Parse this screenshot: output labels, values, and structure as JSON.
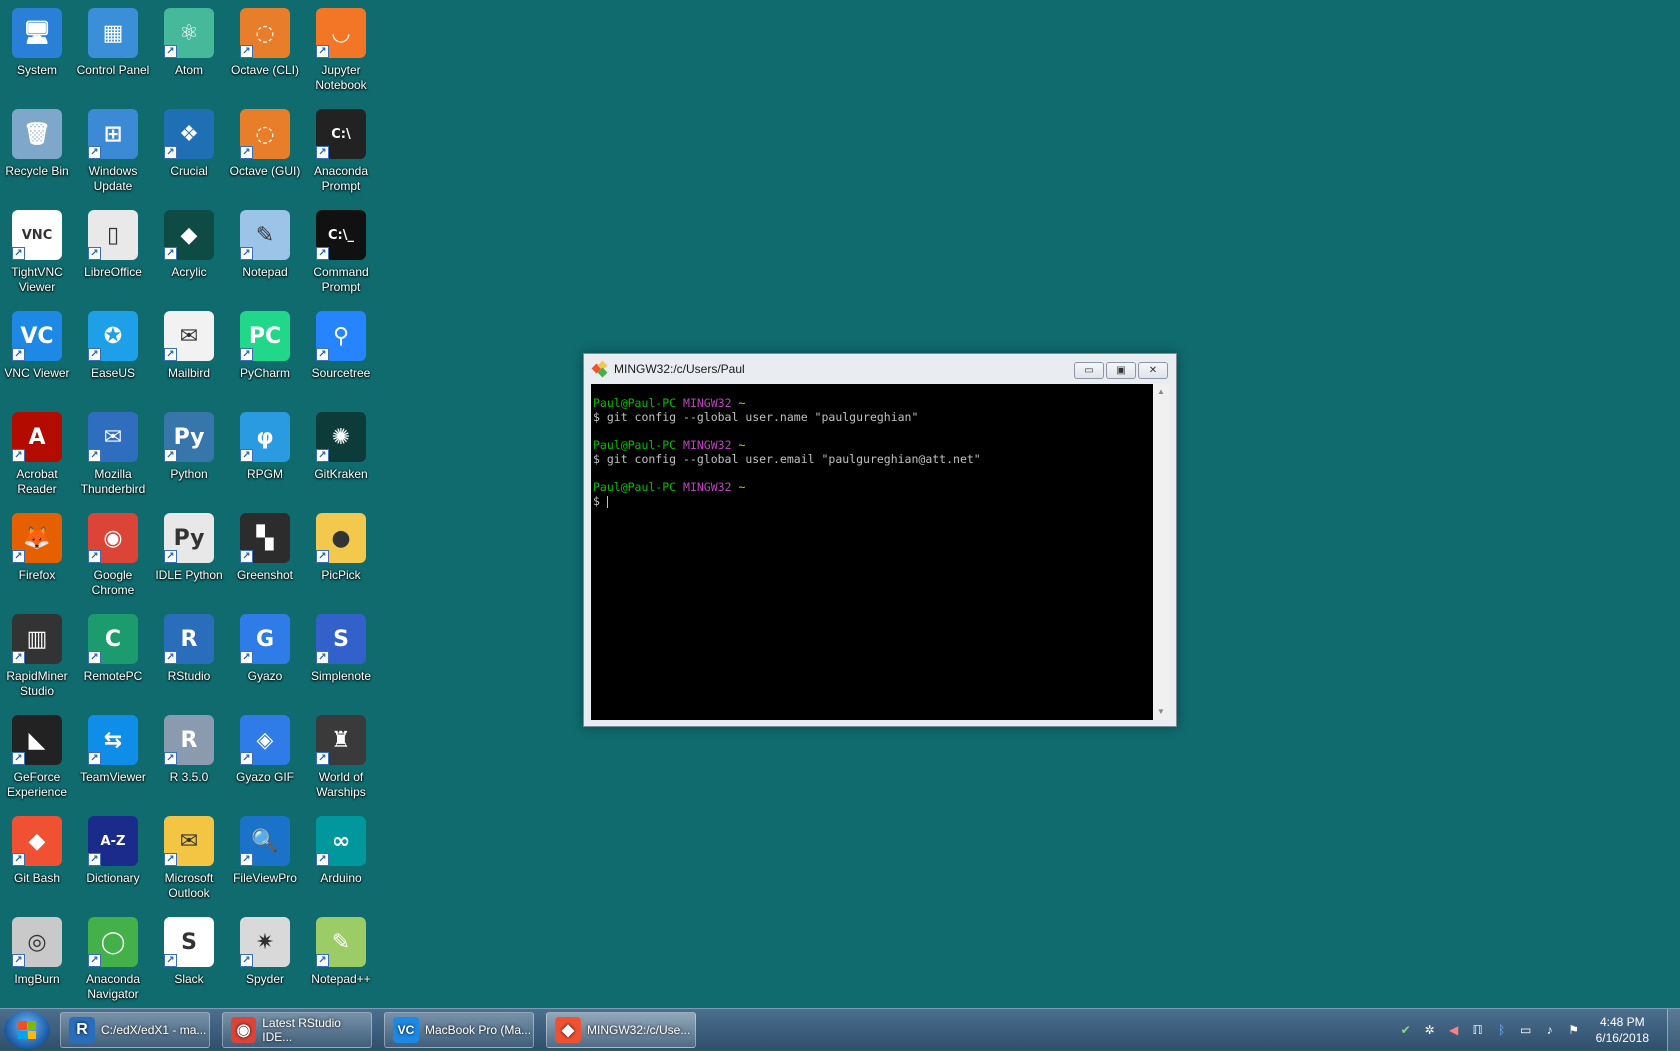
{
  "desktop": {
    "icons": [
      {
        "label": "System",
        "color": "#2a7fd6",
        "glyph": "🖥",
        "shortcut": false
      },
      {
        "label": "Control Panel",
        "color": "#3a8fd8",
        "glyph": "▦",
        "shortcut": false
      },
      {
        "label": "Atom",
        "color": "#46b99a",
        "glyph": "⚛",
        "shortcut": true
      },
      {
        "label": "Octave (CLI)",
        "color": "#e87d2a",
        "glyph": "◌",
        "shortcut": true
      },
      {
        "label": "Jupyter Notebook",
        "color": "#f37626",
        "glyph": "◡",
        "shortcut": true
      },
      {
        "label": "Recycle Bin",
        "color": "#7fa7c9",
        "glyph": "🗑",
        "shortcut": false
      },
      {
        "label": "Windows Update",
        "color": "#3c8ad6",
        "glyph": "⊞",
        "shortcut": true
      },
      {
        "label": "Crucial",
        "color": "#1f6fb5",
        "glyph": "❖",
        "shortcut": true
      },
      {
        "label": "Octave (GUI)",
        "color": "#e87d2a",
        "glyph": "◌",
        "shortcut": true
      },
      {
        "label": "Anaconda Prompt",
        "color": "#222222",
        "glyph": "C:\\",
        "shortcut": true
      },
      {
        "label": "TightVNC Viewer",
        "color": "#ffffff",
        "glyph": "VNC",
        "shortcut": true
      },
      {
        "label": "LibreOffice",
        "color": "#e9e9e9",
        "glyph": "▯",
        "shortcut": true
      },
      {
        "label": "Acrylic",
        "color": "#0f4b45",
        "glyph": "◆",
        "shortcut": true
      },
      {
        "label": "Notepad",
        "color": "#9cc4e8",
        "glyph": "✎",
        "shortcut": true
      },
      {
        "label": "Command Prompt",
        "color": "#111111",
        "glyph": "C:\\_",
        "shortcut": true
      },
      {
        "label": "VNC Viewer",
        "color": "#1e88e5",
        "glyph": "VC",
        "shortcut": true
      },
      {
        "label": "EaseUS",
        "color": "#1ea0e8",
        "glyph": "✪",
        "shortcut": true
      },
      {
        "label": "Mailbird",
        "color": "#f2f2f2",
        "glyph": "✉",
        "shortcut": true
      },
      {
        "label": "PyCharm",
        "color": "#21d789",
        "glyph": "PC",
        "shortcut": true
      },
      {
        "label": "Sourcetree",
        "color": "#2684ff",
        "glyph": "⚲",
        "shortcut": true
      },
      {
        "label": "Acrobat Reader",
        "color": "#b30b00",
        "glyph": "A",
        "shortcut": true
      },
      {
        "label": "Mozilla Thunderbird",
        "color": "#2f6dbf",
        "glyph": "✉",
        "shortcut": true
      },
      {
        "label": "Python",
        "color": "#3776ab",
        "glyph": "Py",
        "shortcut": true
      },
      {
        "label": "RPGM",
        "color": "#2a9be0",
        "glyph": "φ",
        "shortcut": true
      },
      {
        "label": "GitKraken",
        "color": "#0c3b3a",
        "glyph": "✺",
        "shortcut": true
      },
      {
        "label": "Firefox",
        "color": "#e66000",
        "glyph": "🦊",
        "shortcut": true
      },
      {
        "label": "Google Chrome",
        "color": "#db4437",
        "glyph": "◉",
        "shortcut": true
      },
      {
        "label": "IDLE Python",
        "color": "#e8e8e8",
        "glyph": "Py",
        "shortcut": true
      },
      {
        "label": "Greenshot",
        "color": "#2c2c2c",
        "glyph": "▚",
        "shortcut": true
      },
      {
        "label": "PicPick",
        "color": "#f2c94c",
        "glyph": "●",
        "shortcut": true
      },
      {
        "label": "RapidMiner Studio",
        "color": "#333333",
        "glyph": "▥",
        "shortcut": true
      },
      {
        "label": "RemotePC",
        "color": "#1c9b6e",
        "glyph": "C",
        "shortcut": true
      },
      {
        "label": "RStudio",
        "color": "#2a6ebb",
        "glyph": "R",
        "shortcut": true
      },
      {
        "label": "Gyazo",
        "color": "#2f7ce8",
        "glyph": "G",
        "shortcut": true
      },
      {
        "label": "Simplenote",
        "color": "#3361cc",
        "glyph": "S",
        "shortcut": true
      },
      {
        "label": "GeForce Experience",
        "color": "#222222",
        "glyph": "◣",
        "shortcut": true
      },
      {
        "label": "TeamViewer",
        "color": "#0e8ee9",
        "glyph": "⇆",
        "shortcut": true
      },
      {
        "label": "R 3.5.0",
        "color": "#8a9bb0",
        "glyph": "R",
        "shortcut": true
      },
      {
        "label": "Gyazo GIF",
        "color": "#2f7ce8",
        "glyph": "◈",
        "shortcut": true
      },
      {
        "label": "World of Warships",
        "color": "#3a3a3a",
        "glyph": "♜",
        "shortcut": true
      },
      {
        "label": "Git Bash",
        "color": "#f05133",
        "glyph": "◆",
        "shortcut": true
      },
      {
        "label": "Dictionary",
        "color": "#1a2b8c",
        "glyph": "A-Z",
        "shortcut": true
      },
      {
        "label": "Microsoft Outlook",
        "color": "#f4c542",
        "glyph": "✉",
        "shortcut": true
      },
      {
        "label": "FileViewPro",
        "color": "#1a73c9",
        "glyph": "🔍",
        "shortcut": true
      },
      {
        "label": "Arduino",
        "color": "#00979d",
        "glyph": "∞",
        "shortcut": true
      },
      {
        "label": "ImgBurn",
        "color": "#c9c9c9",
        "glyph": "◎",
        "shortcut": true
      },
      {
        "label": "Anaconda Navigator",
        "color": "#43b049",
        "glyph": "◯",
        "shortcut": true
      },
      {
        "label": "Slack",
        "color": "#ffffff",
        "glyph": "S",
        "shortcut": true
      },
      {
        "label": "Spyder",
        "color": "#d9d9d9",
        "glyph": "✷",
        "shortcut": true
      },
      {
        "label": "Notepad++",
        "color": "#9ccc65",
        "glyph": "✎",
        "shortcut": true
      }
    ]
  },
  "window": {
    "title": "MINGW32:/c/Users/Paul",
    "minimize": "▭",
    "maximize": "▣",
    "close": "✕"
  },
  "terminal": {
    "user": "Paul@Paul-PC",
    "env": "MINGW32",
    "path": "~",
    "cmd1": "$ git config --global user.name \"paulgureghian\"",
    "cmd2": "$ git config --global user.email \"paulgureghian@att.net\"",
    "prompt": "$ "
  },
  "taskbar": {
    "items": [
      {
        "label": "C:/edX/edX1 - ma...",
        "glyph": "R",
        "color": "#2a6ebb"
      },
      {
        "label": "Latest RStudio IDE...",
        "glyph": "◉",
        "color": "#db4437"
      },
      {
        "label": "MacBook Pro (Ma...",
        "glyph": "VC",
        "color": "#1e88e5"
      },
      {
        "label": "MINGW32:/c/Use...",
        "glyph": "◆",
        "color": "#f05133"
      }
    ],
    "time": "4:48 PM",
    "date": "6/16/2018"
  }
}
